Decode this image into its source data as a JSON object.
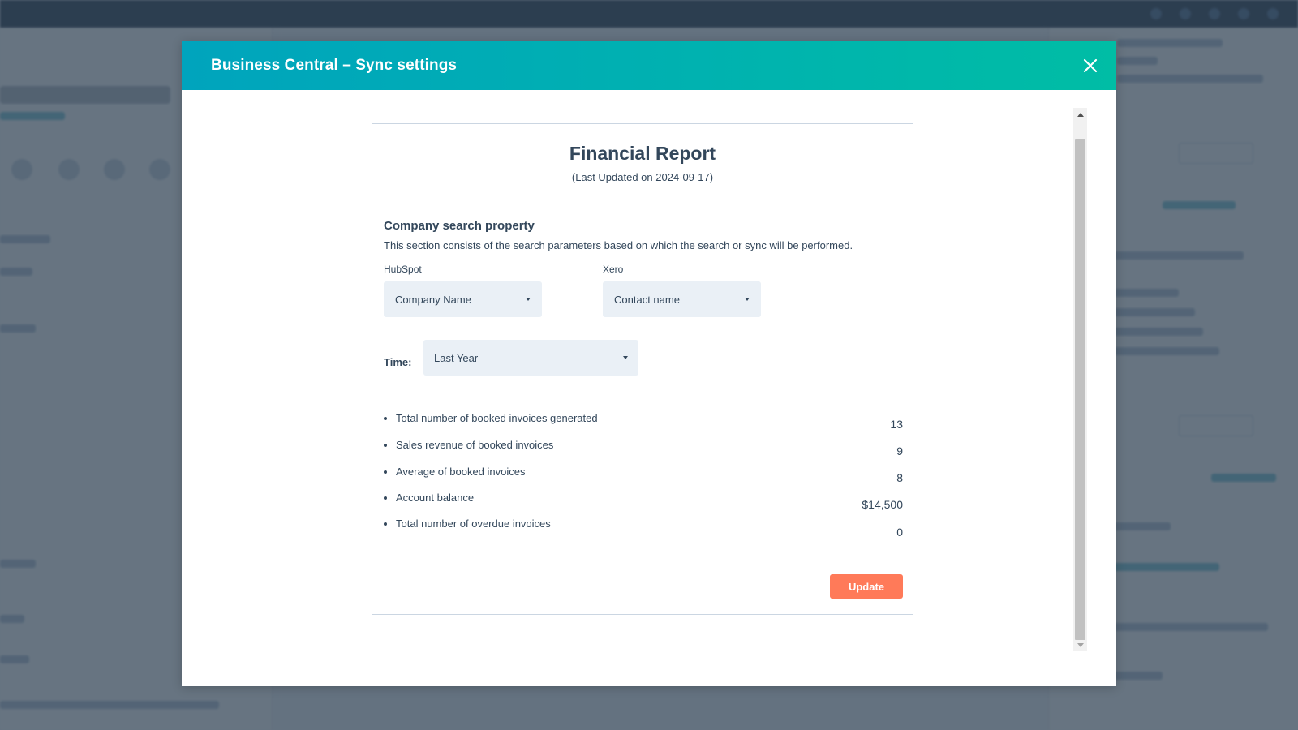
{
  "modal": {
    "title": "Business Central – Sync settings",
    "close_icon": "close-icon"
  },
  "report": {
    "title": "Financial Report",
    "subtitle": "(Last Updated on 2024-09-17)",
    "section_title": "Company search property",
    "section_description": "This section consists of the search parameters based on which the search or sync will be performed.",
    "hubspot": {
      "label": "HubSpot",
      "value": "Company Name"
    },
    "xero": {
      "label": "Xero",
      "value": "Contact name"
    },
    "time": {
      "label": "Time:",
      "value": "Last Year"
    },
    "metrics": [
      {
        "label": "Total number of booked invoices generated",
        "value": "13"
      },
      {
        "label": "Sales revenue of booked invoices",
        "value": "9"
      },
      {
        "label": "Average of booked invoices",
        "value": "8"
      },
      {
        "label": "Account balance",
        "value": "$14,500"
      },
      {
        "label": "Total number of overdue invoices",
        "value": "0"
      }
    ],
    "update_label": "Update"
  },
  "colors": {
    "header_gradient_start": "#00a4bd",
    "header_gradient_end": "#00bda5",
    "update_button": "#ff7a59",
    "select_bg": "#eaf0f6",
    "text": "#33475b"
  }
}
